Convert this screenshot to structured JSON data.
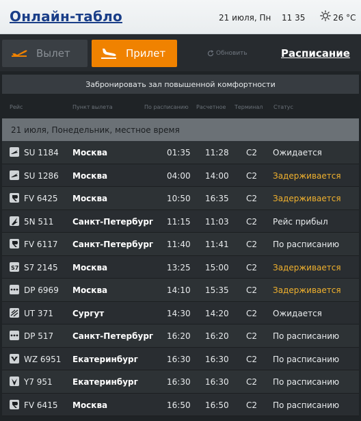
{
  "header": {
    "title": "Онлайн-табло",
    "date": "21 июля, Пн",
    "time": "11 35",
    "weather_icon": "sun-icon",
    "temperature": "26 °C"
  },
  "tabs": {
    "departure": "Вылет",
    "arrival": "Прилет",
    "active": "arrival"
  },
  "refresh_label": "Обновить",
  "schedule_link": "Расписание",
  "booking_banner": "Забронировать зал повышенной комфортности",
  "columns": {
    "flight": "Рейс",
    "origin": "Пункт вылета",
    "scheduled": "По расписанию",
    "estimated": "Расчетное",
    "terminal": "Терминал",
    "status": "Статус"
  },
  "day_header": "21 июля, Понедельник, местное время",
  "colors": {
    "accent": "#f08200",
    "delayed": "#f0b12e",
    "brand": "#1a3e88"
  },
  "flights": [
    {
      "flight": "SU 1184",
      "origin": "Москва",
      "scheduled": "01:35",
      "estimated": "11:28",
      "terminal": "C2",
      "status": "Ожидается",
      "delayed": false,
      "airline_logo": "aeroflot-logo-icon"
    },
    {
      "flight": "SU 1286",
      "origin": "Москва",
      "scheduled": "04:00",
      "estimated": "14:00",
      "terminal": "C2",
      "status": "Задерживается",
      "delayed": true,
      "airline_logo": "aeroflot-logo-icon"
    },
    {
      "flight": "FV 6425",
      "origin": "Москва",
      "scheduled": "10:50",
      "estimated": "16:35",
      "terminal": "C2",
      "status": "Задерживается",
      "delayed": true,
      "airline_logo": "rossiya-logo-icon"
    },
    {
      "flight": "5N 511",
      "origin": "Санкт-Петербург",
      "scheduled": "11:15",
      "estimated": "11:03",
      "terminal": "C2",
      "status": "Рейс прибыл",
      "delayed": false,
      "airline_logo": "nordavia-logo-icon"
    },
    {
      "flight": "FV 6117",
      "origin": "Санкт-Петербург",
      "scheduled": "11:40",
      "estimated": "11:41",
      "terminal": "C2",
      "status": "По расписанию",
      "delayed": false,
      "airline_logo": "rossiya-logo-icon"
    },
    {
      "flight": "S7 2145",
      "origin": "Москва",
      "scheduled": "13:25",
      "estimated": "15:00",
      "terminal": "C2",
      "status": "Задерживается",
      "delayed": true,
      "airline_logo": "s7-logo-icon"
    },
    {
      "flight": "DP 6969",
      "origin": "Москва",
      "scheduled": "14:10",
      "estimated": "15:35",
      "terminal": "C2",
      "status": "Задерживается",
      "delayed": true,
      "airline_logo": "pobeda-logo-icon"
    },
    {
      "flight": "UT 371",
      "origin": "Сургут",
      "scheduled": "14:30",
      "estimated": "14:20",
      "terminal": "C2",
      "status": "Ожидается",
      "delayed": false,
      "airline_logo": "utair-logo-icon"
    },
    {
      "flight": "DP 517",
      "origin": "Санкт-Петербург",
      "scheduled": "16:20",
      "estimated": "16:20",
      "terminal": "C2",
      "status": "По расписанию",
      "delayed": false,
      "airline_logo": "pobeda-logo-icon"
    },
    {
      "flight": "WZ 6951",
      "origin": "Екатеринбург",
      "scheduled": "16:30",
      "estimated": "16:30",
      "terminal": "C2",
      "status": "По расписанию",
      "delayed": false,
      "airline_logo": "redwings-logo-icon"
    },
    {
      "flight": "Y7 951",
      "origin": "Екатеринбург",
      "scheduled": "16:30",
      "estimated": "16:30",
      "terminal": "C2",
      "status": "По расписанию",
      "delayed": false,
      "airline_logo": "nordstar-logo-icon"
    },
    {
      "flight": "FV 6415",
      "origin": "Москва",
      "scheduled": "16:50",
      "estimated": "16:50",
      "terminal": "C2",
      "status": "По расписанию",
      "delayed": false,
      "airline_logo": "rossiya-logo-icon"
    }
  ]
}
